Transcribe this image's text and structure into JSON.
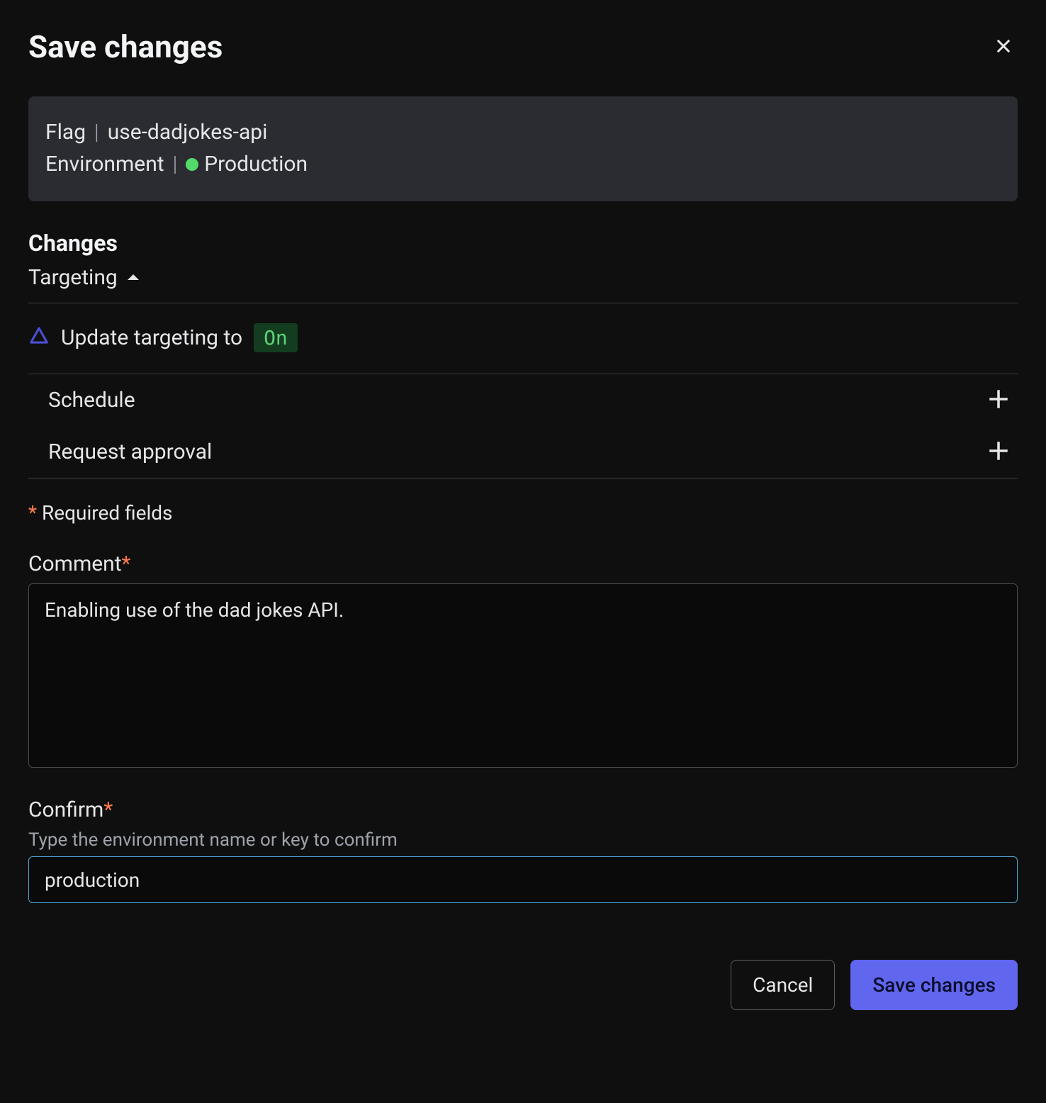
{
  "modal": {
    "title": "Save changes"
  },
  "context": {
    "flag_label": "Flag",
    "flag_value": "use-dadjokes-api",
    "env_label": "Environment",
    "env_value": "Production",
    "env_status_color": "#53d86a"
  },
  "changes": {
    "heading": "Changes",
    "section_label": "Targeting",
    "item_prefix": "Update targeting to",
    "item_state": "On"
  },
  "actions": {
    "schedule": "Schedule",
    "approval": "Request approval"
  },
  "form": {
    "required_note": "Required fields",
    "comment_label": "Comment",
    "comment_value": "Enabling use of the dad jokes API.",
    "confirm_label": "Confirm",
    "confirm_hint": "Type the environment name or key to confirm",
    "confirm_value": "production"
  },
  "footer": {
    "cancel": "Cancel",
    "save": "Save changes"
  }
}
